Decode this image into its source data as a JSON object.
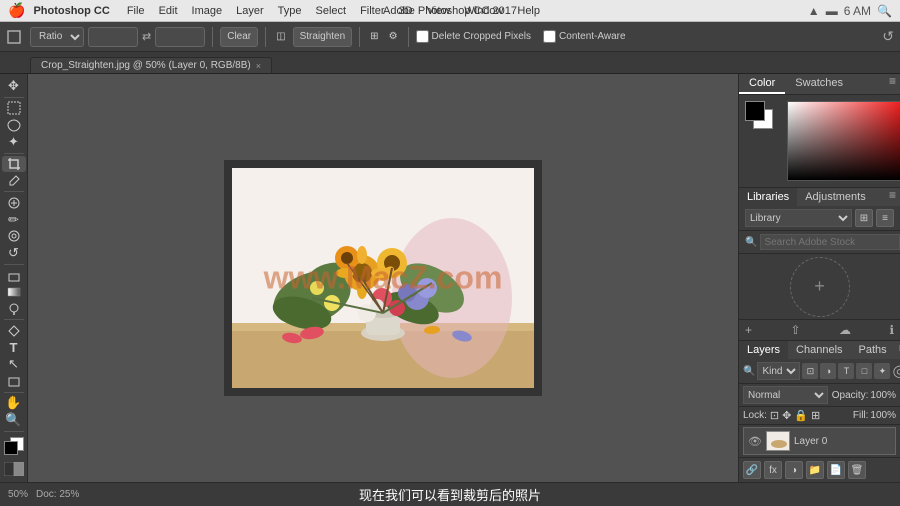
{
  "app": {
    "title": "Adobe Photoshop CC 2017",
    "name": "Photoshop CC"
  },
  "menubar": {
    "apple": "🍎",
    "items": [
      "Photoshop CC",
      "File",
      "Edit",
      "Image",
      "Layer",
      "Type",
      "Select",
      "Filter",
      "3D",
      "View",
      "Window",
      "Help"
    ],
    "right_icons": [
      "wifi",
      "battery",
      "clock",
      "search"
    ],
    "time": "6 AM"
  },
  "toolbar": {
    "ratio_label": "Ratio",
    "clear_label": "Clear",
    "straighten_label": "Straighten",
    "delete_cropped_label": "Delete Cropped Pixels",
    "content_aware_label": "Content-Aware"
  },
  "tab": {
    "filename": "Crop_Straighten.jpg @ 50% (Layer 0, RGB/8B)",
    "close": "×"
  },
  "color_panel": {
    "tab1": "Color",
    "tab2": "Swatches"
  },
  "libraries_panel": {
    "tab1": "Libraries",
    "tab2": "Adjustments",
    "library_select": "Library",
    "search_placeholder": "Search Adobe Stock"
  },
  "layers_panel": {
    "tab1": "Layers",
    "tab2": "Channels",
    "tab3": "Paths",
    "filter_label": "Kind",
    "blend_mode": "Normal",
    "opacity_label": "Opacity:",
    "opacity_value": "100%",
    "fill_label": "Fill:",
    "fill_value": "100%",
    "lock_label": "Lock:",
    "layer_name": "Layer 0"
  },
  "bottom_bar": {
    "left": "50%",
    "doc_size": "Doc: 25%",
    "subtitle": "现在我们可以看到裁剪后的照片"
  },
  "watermark": {
    "text": "www.MacZ.com"
  },
  "tools": [
    {
      "name": "move",
      "icon": "✥"
    },
    {
      "name": "select-rect",
      "icon": "▭"
    },
    {
      "name": "lasso",
      "icon": "⌒"
    },
    {
      "name": "magic-wand",
      "icon": "✦"
    },
    {
      "name": "crop",
      "icon": "⊡"
    },
    {
      "name": "eyedropper",
      "icon": "⊘"
    },
    {
      "name": "spot-heal",
      "icon": "⊕"
    },
    {
      "name": "brush",
      "icon": "✏"
    },
    {
      "name": "clone-stamp",
      "icon": "⊗"
    },
    {
      "name": "history-brush",
      "icon": "↺"
    },
    {
      "name": "eraser",
      "icon": "◫"
    },
    {
      "name": "gradient",
      "icon": "◧"
    },
    {
      "name": "dodge",
      "icon": "○"
    },
    {
      "name": "pen",
      "icon": "✒"
    },
    {
      "name": "type",
      "icon": "T"
    },
    {
      "name": "path-select",
      "icon": "↖"
    },
    {
      "name": "rectangle",
      "icon": "□"
    },
    {
      "name": "hand",
      "icon": "✋"
    },
    {
      "name": "zoom",
      "icon": "🔍"
    }
  ]
}
